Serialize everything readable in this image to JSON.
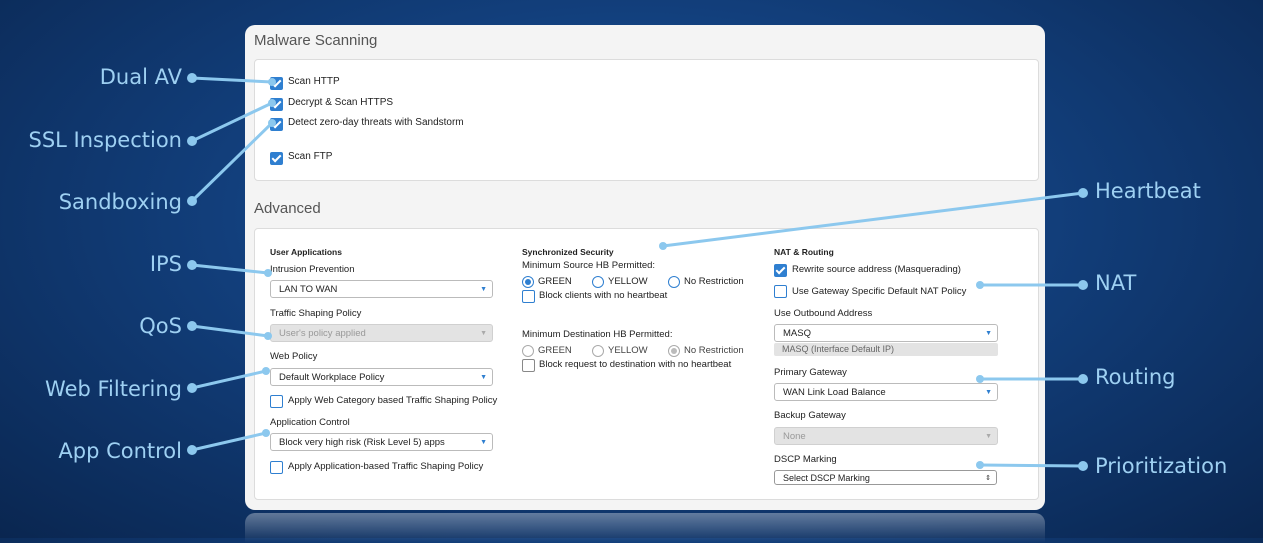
{
  "callouts": {
    "dual_av": "Dual AV",
    "ssl_inspection": "SSL Inspection",
    "sandboxing": "Sandboxing",
    "ips": "IPS",
    "qos": "QoS",
    "web_filtering": "Web Filtering",
    "app_control": "App Control",
    "heartbeat": "Heartbeat",
    "nat": "NAT",
    "routing": "Routing",
    "prioritization": "Prioritization"
  },
  "callout_color": "#8cc8ee",
  "accent_color": "#2f7fd0",
  "malware": {
    "title": "Malware Scanning",
    "scan_http": "Scan HTTP",
    "decrypt_https": "Decrypt & Scan HTTPS",
    "sandstorm": "Detect zero-day threats with Sandstorm",
    "scan_ftp": "Scan FTP"
  },
  "advanced": {
    "title": "Advanced",
    "user_apps": {
      "heading": "User Applications",
      "intrusion_label": "Intrusion Prevention",
      "intrusion_value": "LAN TO WAN",
      "shaping_label": "Traffic Shaping Policy",
      "shaping_value": "User's policy applied",
      "web_label": "Web Policy",
      "web_value": "Default Workplace Policy",
      "web_shaping_cb": "Apply Web Category based Traffic Shaping Policy",
      "app_label": "Application Control",
      "app_value": "Block very high risk (Risk Level 5) apps",
      "app_shaping_cb": "Apply Application-based Traffic Shaping Policy"
    },
    "sync": {
      "heading": "Synchronized Security",
      "source_label": "Minimum Source HB Permitted:",
      "green": "GREEN",
      "yellow": "YELLOW",
      "no_restriction": "No Restriction",
      "block_clients": "Block clients with no heartbeat",
      "dest_label": "Minimum Destination HB Permitted:",
      "block_request": "Block request to destination with no heartbeat"
    },
    "nat": {
      "heading": "NAT & Routing",
      "rewrite_cb": "Rewrite source address (Masquerading)",
      "gateway_nat_cb": "Use Gateway Specific Default NAT Policy",
      "outbound_label": "Use Outbound Address",
      "outbound_value": "MASQ",
      "outbound_note": "MASQ (Interface Default IP)",
      "primary_label": "Primary Gateway",
      "primary_value": "WAN Link Load Balance",
      "backup_label": "Backup Gateway",
      "backup_value": "None",
      "dscp_label": "DSCP Marking",
      "dscp_value": "Select DSCP Marking"
    }
  }
}
